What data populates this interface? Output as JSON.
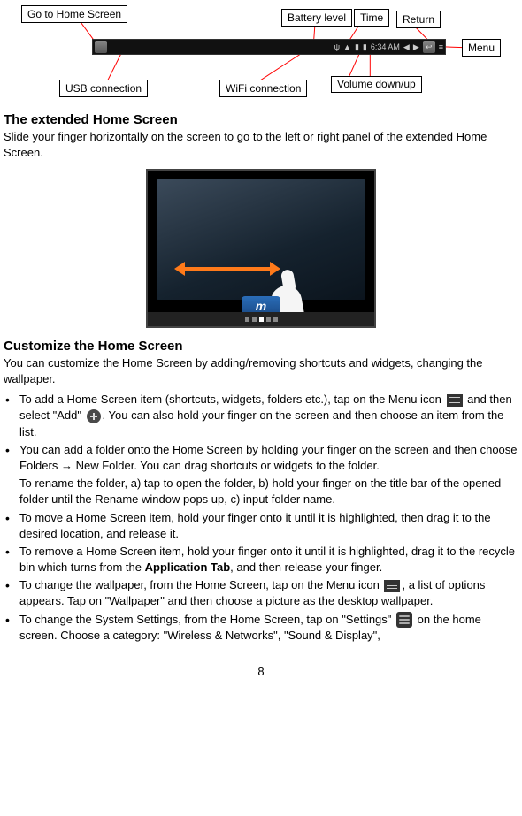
{
  "labels": {
    "go_home": "Go to Home Screen",
    "battery": "Battery level",
    "time": "Time",
    "ret": "Return",
    "menu": "Menu",
    "usb": "USB connection",
    "wifi": "WiFi connection",
    "volume": "Volume down/up"
  },
  "status": {
    "time": "6:34 AM"
  },
  "section1": {
    "heading": "The extended Home Screen",
    "body": "Slide your finger horizontally on the screen to go to the left or right panel of the extended Home Screen."
  },
  "section2": {
    "heading": "Customize the Home Screen",
    "intro": "You can customize the Home Screen by adding/removing shortcuts and widgets, changing the wallpaper.",
    "b1a": "To add a Home Screen item (shortcuts, widgets, folders etc.), tap on the Menu icon ",
    "b1b": " and then select \"Add\" ",
    "b1c": ". You can also hold your finger on the screen and then choose an item from the list.",
    "b2a": "You can add a folder onto the Home Screen by holding your finger on the screen and then choose Folders → New Folder. You can drag shortcuts or widgets to the folder.",
    "b2b": "To rename the folder, a) tap to open the folder, b) hold your finger on the title bar of the opened folder until the Rename window pops up, c) input folder name.",
    "b3": "To move a Home Screen item, hold your finger onto it until it is highlighted, then drag it to the desired location, and release it.",
    "b4a": "To remove a Home Screen item, hold your finger onto it until it is highlighted, drag it to the recycle bin which turns from the ",
    "b4bold": "Application Tab",
    "b4b": ", and then release your finger.",
    "b5a": "To change the wallpaper, from the Home Screen, tap on the Menu icon ",
    "b5b": ", a list of options appears. Tap on \"Wallpaper\" and then choose a picture as the desktop wallpaper.",
    "b6a": "To change the System Settings, from the Home Screen, tap on \"Settings\" ",
    "b6b": " on the home screen. Choose a category: \"Wireless & Networks\", \"Sound & Display\","
  },
  "page_number": "8"
}
